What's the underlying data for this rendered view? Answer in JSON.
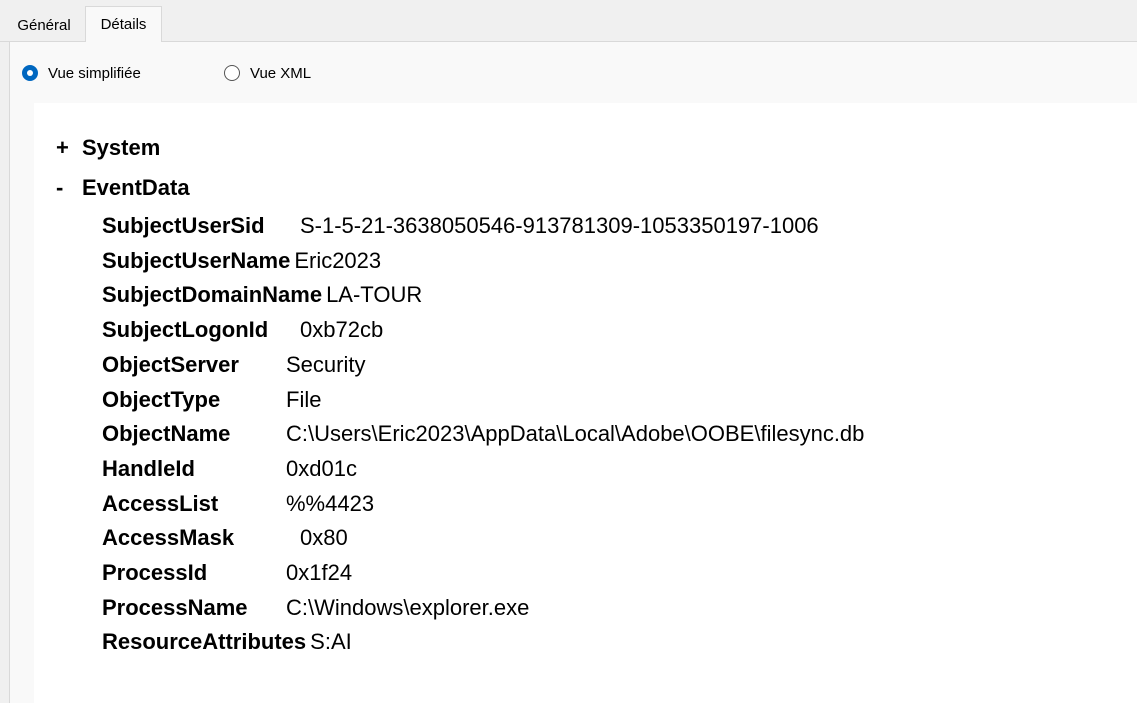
{
  "tabs": {
    "general": "Général",
    "details": "Détails"
  },
  "view_options": {
    "simple": "Vue simplifiée",
    "xml": "Vue XML",
    "selected": "simple"
  },
  "tree": {
    "system": {
      "toggle": "+",
      "label": "System"
    },
    "eventdata": {
      "toggle": "-",
      "label": "EventData",
      "fields": [
        {
          "key": "SubjectUserSid",
          "value": "S-1-5-21-3638050546-913781309-1053350197-1006"
        },
        {
          "key": "SubjectUserName",
          "value": "Eric2023"
        },
        {
          "key": "SubjectDomainName",
          "value": "LA-TOUR"
        },
        {
          "key": "SubjectLogonId",
          "value": "0xb72cb"
        },
        {
          "key": "ObjectServer",
          "value": "Security"
        },
        {
          "key": "ObjectType",
          "value": "File"
        },
        {
          "key": "ObjectName",
          "value": "C:\\Users\\Eric2023\\AppData\\Local\\Adobe\\OOBE\\filesync.db"
        },
        {
          "key": "HandleId",
          "value": "0xd01c"
        },
        {
          "key": "AccessList",
          "value": "%%4423"
        },
        {
          "key": "AccessMask",
          "value": "0x80"
        },
        {
          "key": "ProcessId",
          "value": "0x1f24"
        },
        {
          "key": "ProcessName",
          "value": "C:\\Windows\\explorer.exe"
        },
        {
          "key": "ResourceAttributes",
          "value": "S:AI"
        }
      ]
    }
  }
}
